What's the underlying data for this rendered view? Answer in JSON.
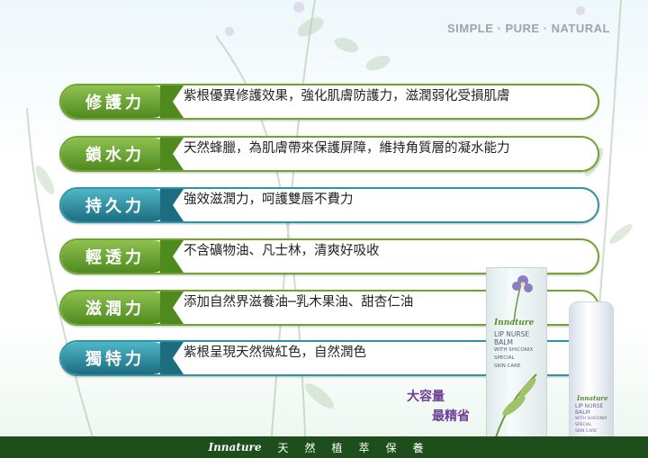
{
  "tagline": "SIMPLE · PURE · NATURAL",
  "features": [
    {
      "title": "修護力",
      "desc": "紫根優異修護效果，強化肌膚防護力，滋潤弱化受損肌膚",
      "color": "green"
    },
    {
      "title": "鎖水力",
      "desc": "天然蜂臘，為肌膚帶來保護屏障，維持角質層的凝水能力",
      "color": "green"
    },
    {
      "title": "持久力",
      "desc": "強效滋潤力，呵護雙唇不費力",
      "color": "teal"
    },
    {
      "title": "輕透力",
      "desc": "不含礦物油、凡士林，清爽好吸收",
      "color": "green"
    },
    {
      "title": "滋潤力",
      "desc": "添加自然界滋養油─乳木果油、甜杏仁油",
      "color": "green"
    },
    {
      "title": "獨特力",
      "desc": "紫根呈現天然微紅色，自然潤色",
      "color": "teal"
    }
  ],
  "product": {
    "brand": "Innature",
    "name_line1": "LIP NURSE BALM",
    "name_line2": "WITH SHICONIX SPECIAL",
    "name_line3": "SKIN CARE"
  },
  "promo": {
    "line1": "大容量",
    "line2": "最精省"
  },
  "footer": {
    "brand": "Innature",
    "slogan": "天然植萃保養"
  },
  "colors": {
    "green": "#6fa52f",
    "teal": "#2e93a4",
    "footer_bg": "#1d4e1b",
    "promo": "#6d3f98"
  }
}
